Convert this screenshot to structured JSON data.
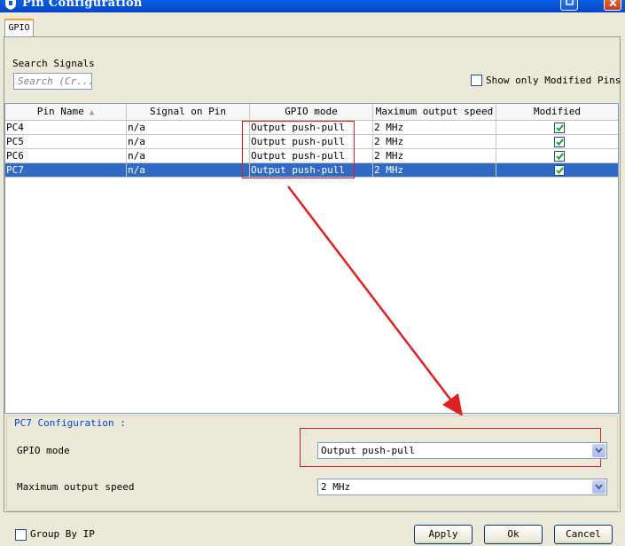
{
  "window": {
    "title": "Pin Configuration"
  },
  "tabs": [
    {
      "label": "GPIO"
    }
  ],
  "search": {
    "label": "Search Signals",
    "placeholder": "Search (Cr..."
  },
  "filter": {
    "show_modified_label": "Show only Modified Pins",
    "checked": false
  },
  "table": {
    "columns": [
      "Pin Name",
      "Signal on Pin",
      "GPIO mode",
      "Maximum output speed",
      "Modified"
    ],
    "rows": [
      {
        "pin": "PC4",
        "signal": "n/a",
        "mode": "Output push-pull",
        "speed": "2 MHz",
        "modified": true
      },
      {
        "pin": "PC5",
        "signal": "n/a",
        "mode": "Output push-pull",
        "speed": "2 MHz",
        "modified": true
      },
      {
        "pin": "PC6",
        "signal": "n/a",
        "mode": "Output push-pull",
        "speed": "2 MHz",
        "modified": true
      },
      {
        "pin": "PC7",
        "signal": "n/a",
        "mode": "Output push-pull",
        "speed": "2 MHz",
        "modified": true
      }
    ],
    "selected_row": 3
  },
  "config": {
    "title": "PC7 Configuration :",
    "gpio_mode_label": "GPIO mode",
    "gpio_mode_value": "Output push-pull",
    "speed_label": "Maximum output speed",
    "speed_value": "2 MHz"
  },
  "footer": {
    "group_by_ip_label": "Group By IP",
    "apply_label": "Apply",
    "ok_label": "Ok",
    "cancel_label": "Cancel"
  },
  "colors": {
    "titlebar": "#0246c8",
    "selection": "#316ac5",
    "annotation": "#e02020",
    "check": "#21a121"
  }
}
